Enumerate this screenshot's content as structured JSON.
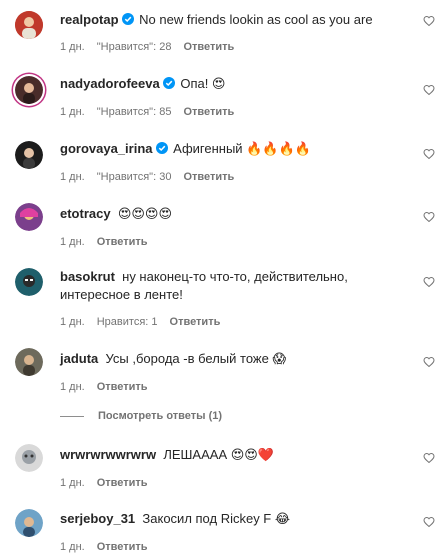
{
  "comments": [
    {
      "user": "realpotap",
      "verified": true,
      "text": "No new friends lookin as cool as you are",
      "time": "1 дн.",
      "likes": "\"Нравится\": 28",
      "reply": "Ответить",
      "avatar_color": "#c0392b"
    },
    {
      "user": "nadyadorofeeva",
      "verified": true,
      "text": "Опа! 😍",
      "time": "1 дн.",
      "likes": "\"Нравится\": 85",
      "reply": "Ответить",
      "avatar_color": "#4a2c2a"
    },
    {
      "user": "gorovaya_irina",
      "verified": true,
      "text": "Афигенный 🔥🔥🔥🔥",
      "time": "1 дн.",
      "likes": "\"Нравится\": 30",
      "reply": "Ответить",
      "avatar_color": "#1c1c1c"
    },
    {
      "user": "etotracy",
      "verified": false,
      "text": "😍😍😍😍",
      "time": "1 дн.",
      "likes": "",
      "reply": "Ответить",
      "avatar_color": "#7b3f8c"
    },
    {
      "user": "basokrut",
      "verified": false,
      "text": "ну наконец-то что-то, действительно, интересное в ленте!",
      "time": "1 дн.",
      "likes": "Нравится: 1",
      "reply": "Ответить",
      "avatar_color": "#1f5f6b"
    },
    {
      "user": "jaduta",
      "verified": false,
      "text": "Усы ,борода -в белый тоже 😱",
      "time": "1 дн.",
      "likes": "",
      "reply": "Ответить",
      "avatar_color": "#6d6a5c"
    },
    {
      "user": "wrwrwrwwrwrw",
      "verified": false,
      "text": "ЛЕШАААА 😍😍❤️",
      "time": "1 дн.",
      "likes": "",
      "reply": "Ответить",
      "avatar_color": "#9aa0a6"
    },
    {
      "user": "serjeboy_31",
      "verified": false,
      "text": "Закосил под Rickey F 😂",
      "time": "1 дн.",
      "likes": "",
      "reply": "Ответить",
      "avatar_color": "#6fa3c7"
    }
  ],
  "thread": {
    "label": "Посмотреть ответы (1)"
  },
  "colors": {
    "verified": "#0095f6",
    "meta": "#737373",
    "text": "#262626"
  }
}
